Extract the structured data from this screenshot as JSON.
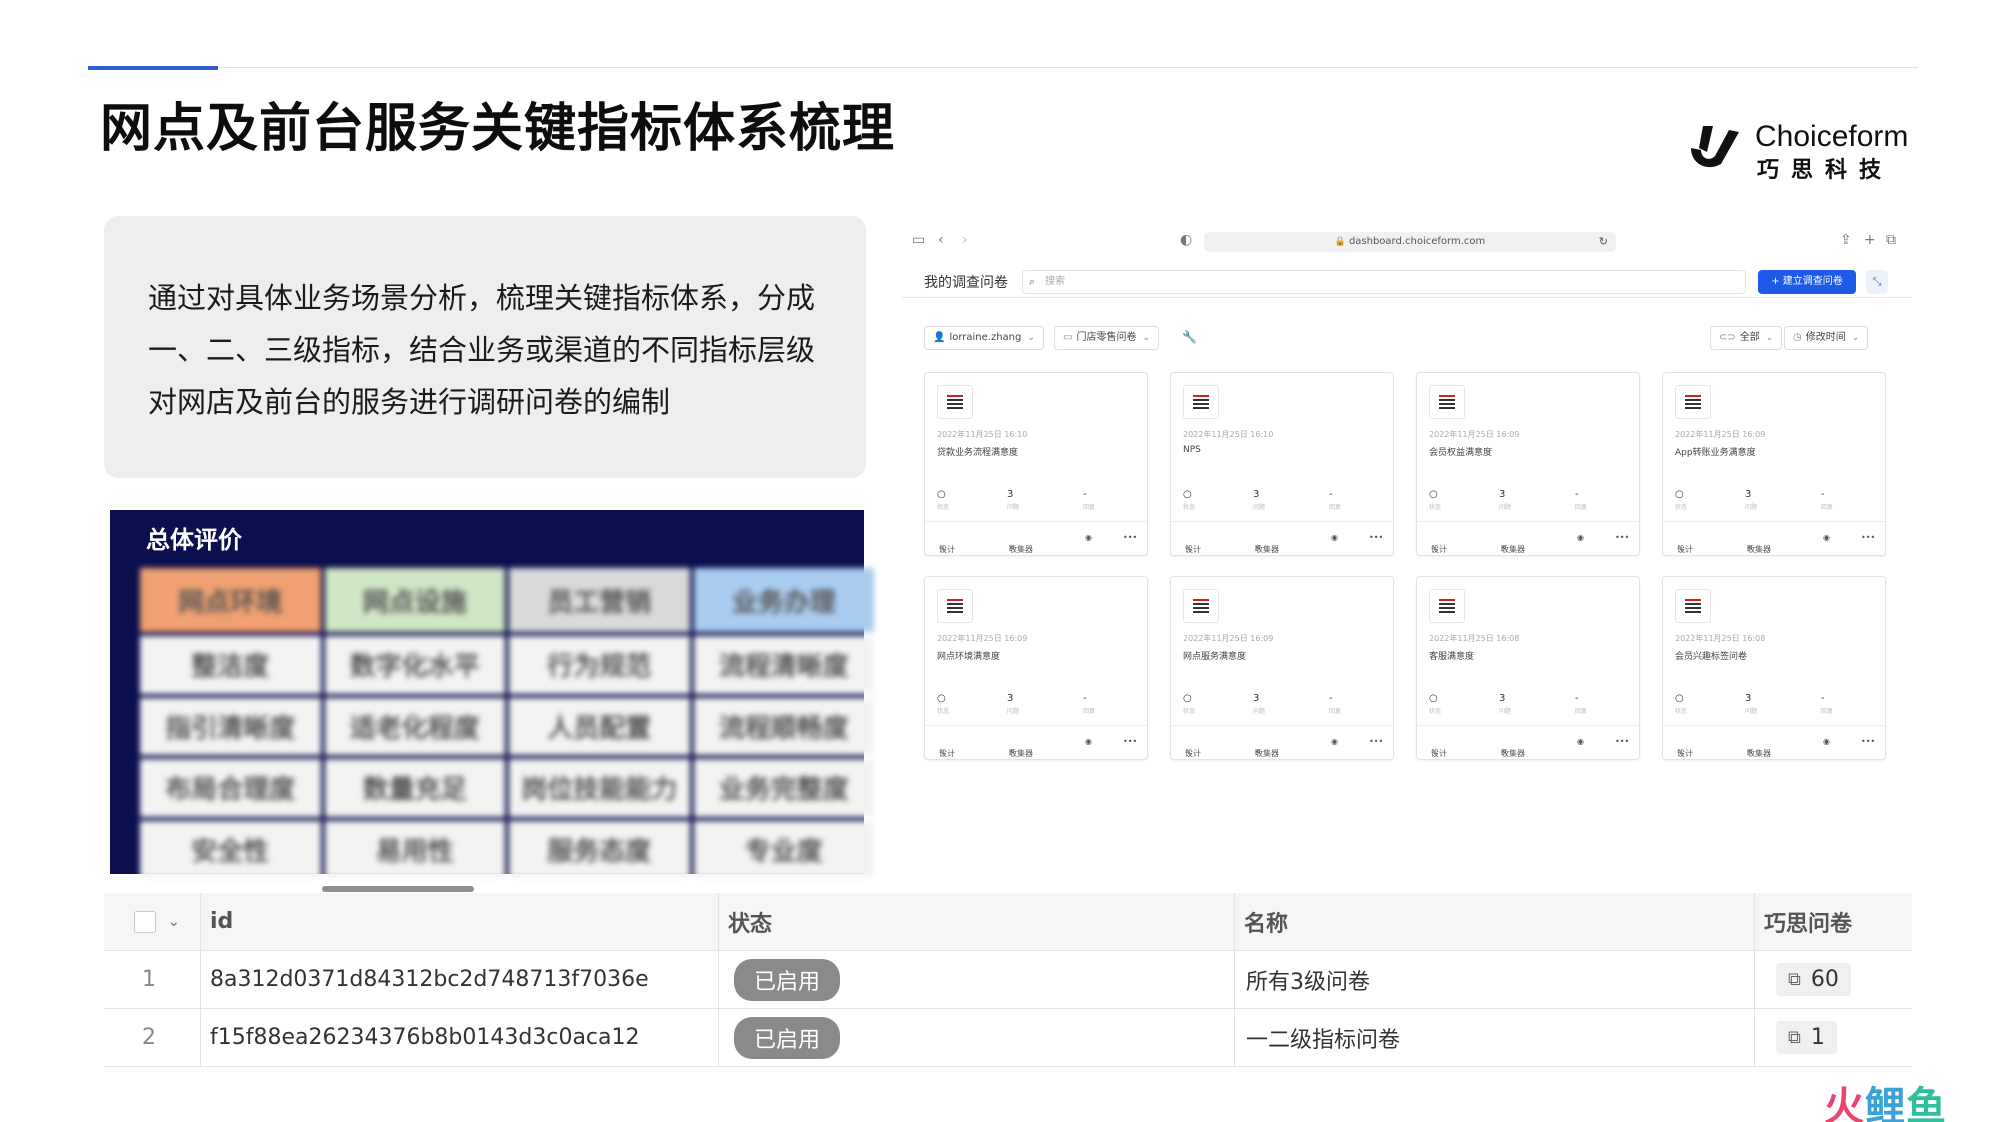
{
  "slide": {
    "title": "网点及前台服务关键指标体系梳理",
    "intro": "通过对具体业务场景分析，梳理关键指标体系，分成一、二、三级指标，结合业务或渠道的不同指标层级对网店及前台的服务进行调研问卷的编制"
  },
  "logo": {
    "en": "Choiceform",
    "cn": "巧思科技"
  },
  "eval_panel": {
    "title": "总体评价",
    "headers": [
      "网点环境",
      "网点设施",
      "员工营销",
      "业务办理"
    ],
    "rows": [
      [
        "整洁度",
        "数字化水平",
        "行为规范",
        "流程清晰度"
      ],
      [
        "指引清晰度",
        "适老化程度",
        "人员配置",
        "流程顺畅度"
      ],
      [
        "布局合理度",
        "数量充足",
        "岗位技能能力",
        "业务完整度"
      ],
      [
        "安全性",
        "易用性",
        "服务态度",
        "专业度"
      ]
    ],
    "header_colors": [
      "#f0a072",
      "#cfe6c4",
      "#d9d9d9",
      "#a9cdef"
    ]
  },
  "browser": {
    "url": "dashboard.choiceform.com",
    "app_title": "我的调查问卷",
    "search_placeholder": "搜索",
    "create_button": "+ 建立调查问卷",
    "filters": {
      "owner": "lorraine.zhang",
      "folder": "门店零售问卷",
      "scope": "全部",
      "sort": "修改时间"
    },
    "cards": [
      {
        "date": "2022年11月25日 16:10",
        "name": "贷款业务流程满意度",
        "status": "○",
        "questions": "3",
        "responses": "-"
      },
      {
        "date": "2022年11月25日 16:10",
        "name": "NPS",
        "status": "○",
        "questions": "3",
        "responses": "-"
      },
      {
        "date": "2022年11月25日 16:09",
        "name": "会员权益满意度",
        "status": "○",
        "questions": "3",
        "responses": "-"
      },
      {
        "date": "2022年11月25日 16:09",
        "name": "App转账业务满意度",
        "status": "○",
        "questions": "3",
        "responses": "-"
      },
      {
        "date": "2022年11月25日 16:09",
        "name": "网点环境满意度",
        "status": "○",
        "questions": "3",
        "responses": "-"
      },
      {
        "date": "2022年11月25日 16:09",
        "name": "网点服务满意度",
        "status": "○",
        "questions": "3",
        "responses": "-"
      },
      {
        "date": "2022年11月25日 16:08",
        "name": "客服满意度",
        "status": "○",
        "questions": "3",
        "responses": "-"
      },
      {
        "date": "2022年11月25日 16:08",
        "name": "会员兴趣标签问卷",
        "status": "○",
        "questions": "3",
        "responses": "-"
      }
    ],
    "stat_labels": {
      "status": "状态",
      "questions": "问题",
      "responses": "回复"
    },
    "action_labels": {
      "design": "设计",
      "collect": "收集器"
    }
  },
  "table": {
    "columns": [
      "id",
      "状态",
      "名称",
      "巧思问卷"
    ],
    "rows": [
      {
        "num": "1",
        "id": "8a312d0371d84312bc2d748713f7036e",
        "status": "已启用",
        "name": "所有3级问卷",
        "count": "60"
      },
      {
        "num": "2",
        "id": "f15f88ea26234376b8b0143d3c0aca12",
        "status": "已启用",
        "name": "一二级指标问卷",
        "count": "1"
      }
    ]
  },
  "watermark": {
    "part1": "火",
    "part2": "鲤",
    "part3": "鱼"
  },
  "colors": {
    "accent": "#2f5fd0",
    "primary_button": "#1e5ae8",
    "panel_bg": "#0b0f4e",
    "badge": "#8a8a8a"
  }
}
